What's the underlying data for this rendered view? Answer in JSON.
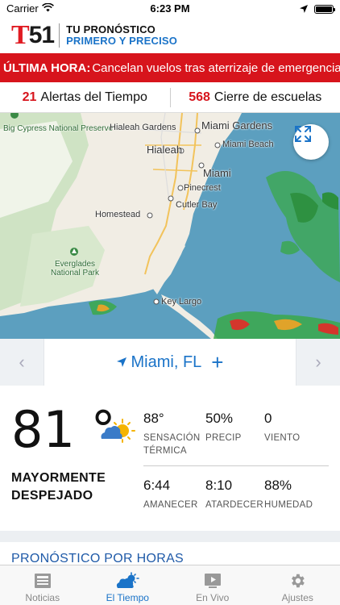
{
  "status": {
    "carrier": "Carrier",
    "time": "6:23 PM"
  },
  "header": {
    "logo_letter": "T",
    "logo_number": "51",
    "tagline_1": "TU PRONÓSTICO",
    "tagline_2": "PRIMERO Y PRECISO"
  },
  "breaking": {
    "tag": "ÚLTIMA HORA:",
    "text": "Cancelan vuelos tras aterrizaje de emergencia"
  },
  "alerts": {
    "weather_count": "21",
    "weather_label": "Alertas del Tiempo",
    "schools_count": "568",
    "schools_label": "Cierre de escuelas"
  },
  "map": {
    "labels": {
      "big_cypress": "Big Cypress National Preserve",
      "hialeah_gardens": "Hialeah Gardens",
      "miami_gardens": "Miami Gardens",
      "hialeah": "Hialeah",
      "miami_beach": "Miami Beach",
      "miami": "Miami",
      "pinecrest": "Pinecrest",
      "cutler_bay": "Cutler Bay",
      "homestead": "Homestead",
      "everglades": "Everglades National Park",
      "key_largo": "Key Largo"
    },
    "colors": {
      "water": "#5c9fbf",
      "land": "#f1ede4",
      "park": "#cfe3c4",
      "radar": "#3aa84a"
    }
  },
  "location": {
    "name": "Miami, FL"
  },
  "current": {
    "temperature": "81 °",
    "condition_line1": "MAYORMENTE",
    "condition_line2": "DESPEJADO",
    "feels_like": {
      "value": "88°",
      "label1": "SENSACIÓN",
      "label2": "TÉRMICA"
    },
    "precip": {
      "value": "50%",
      "label": "PRECIP"
    },
    "wind": {
      "value": "0",
      "label": "VIENTO"
    },
    "sunrise": {
      "value": "6:44",
      "label": "AMANECER"
    },
    "sunset": {
      "value": "8:10",
      "label": "ATARDECER"
    },
    "humidity": {
      "value": "88%",
      "label": "HUMEDAD"
    }
  },
  "hourly": {
    "title": "PRONÓSTICO POR HORAS"
  },
  "tabs": [
    {
      "label": "Noticias",
      "icon": "news-icon"
    },
    {
      "label": "El Tiempo",
      "icon": "weather-icon"
    },
    {
      "label": "En Vivo",
      "icon": "live-tv-icon"
    },
    {
      "label": "Ajustes",
      "icon": "gear-icon"
    }
  ]
}
